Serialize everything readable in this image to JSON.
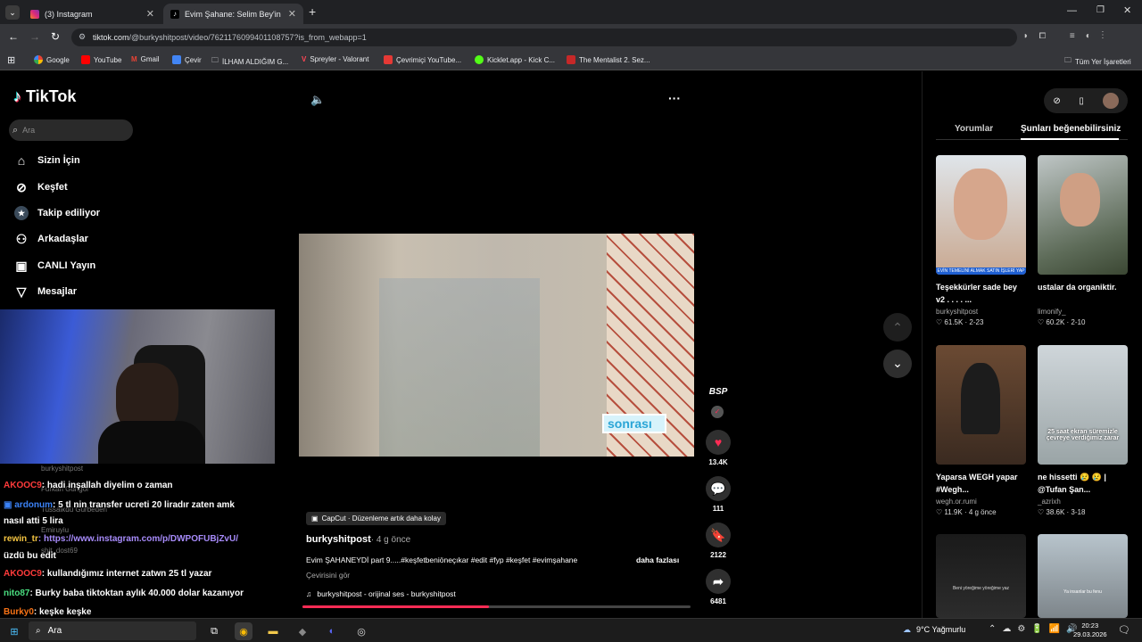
{
  "browser": {
    "tabs": [
      {
        "label": "(3) Instagram"
      },
      {
        "label": "Evim Şahane: Selim Bey'in Dönü"
      }
    ],
    "url_host": "tiktok.com",
    "url_path": "/@burkyshitpost/video/7621176099401108757?is_from_webapp=1",
    "bookmarks": [
      "Google",
      "YouTube",
      "Gmail",
      "Çevir",
      "İLHAM ALDIĞIM G...",
      "Spreyler - Valorant",
      "Çevrimiçi YouTube...",
      "Kicklet.app - Kick C...",
      "The Mentalist 2. Sez..."
    ],
    "bookmarks_right": "Tüm Yer İşaretleri"
  },
  "sidebar": {
    "logo": "TikTok",
    "search_placeholder": "Ara",
    "items": [
      {
        "label": "Sizin İçin",
        "icon": "home-icon"
      },
      {
        "label": "Keşfet",
        "icon": "compass-icon"
      },
      {
        "label": "Takip ediliyor",
        "icon": "following-icon"
      },
      {
        "label": "Arkadaşlar",
        "icon": "friends-icon"
      },
      {
        "label": "CANLI Yayın",
        "icon": "live-icon"
      },
      {
        "label": "Mesajlar",
        "icon": "messages-icon"
      }
    ]
  },
  "video": {
    "caption_overlay": "sonrası",
    "capcut": "CapCut · Düzenleme artık daha kolay",
    "author": "burkyshitpost",
    "age": "· 4 g önce",
    "description": "Evim ŞAHANEYDİ part 9.....#keşfetbeniöneçıkar #edit #fyp #keşfet #evimşahane",
    "more": "daha fazlası",
    "translate": "Çevirisini gör",
    "sound": "burkyshitpost - orijinal ses - burkyshitpost",
    "progress": 0.48,
    "avatar_label": "BSP"
  },
  "actions": {
    "likes": "13.4K",
    "comments": "111",
    "saves": "2122",
    "shares": "6481"
  },
  "rightpanel": {
    "tabs": [
      "Yorumlar",
      "Şunları beğenebilirsiniz"
    ],
    "cards": [
      {
        "title": "Teşekkürler sade bey v2 . . . . ...",
        "author": "burkyshitpost",
        "likes": "61.5K",
        "date": "2-23",
        "overlay": "EVİN TEMELİNİ ALMAK SATIN İŞLERİ YAP"
      },
      {
        "title": "ustalar da organiktir.",
        "author": "limonify_",
        "likes": "60.2K",
        "date": "2-10",
        "overlay": ""
      },
      {
        "title": "Yaparsa WEGH yapar #Wegh...",
        "author": "wegh.or.rumi",
        "likes": "11.9K",
        "date": "4 g önce",
        "overlay": ""
      },
      {
        "title": "ne hissetti 😢 😢 | @Tufan Şan...",
        "author": "_azrixh",
        "likes": "38.6K",
        "date": "3-18",
        "overlay": "25 saat ekran süremizle çevreye verdiğimiz zarar"
      },
      {
        "title": "",
        "author": "",
        "likes": "",
        "date": "",
        "overlay": "Beni yöreğime yöreğime yaz"
      },
      {
        "title": "",
        "author": "",
        "likes": "",
        "date": "",
        "overlay": "Ya insanlar bu fenu"
      }
    ]
  },
  "chat": [
    {
      "user": "AKOOC9",
      "text": ": hadi inşallah diyelim o zaman",
      "color": "#ff3b3b"
    },
    {
      "user": "ardonum",
      "text": ": 5 tl nin transfer ucreti 20 liradır zaten amk",
      "color": "#3b82f6"
    },
    {
      "user": "",
      "text": "nasıl atti 5 lira",
      "color": "#fff"
    },
    {
      "user": "rewin_tr",
      "text": ": https://www.instagram.com/p/DWPOFUBjZvU/",
      "color": "#f5c542"
    },
    {
      "user": "",
      "text": "üzdü bu edit",
      "color": "#fff"
    },
    {
      "user": "AKOOC9",
      "text": ": kullandığımız internet zatwn 25 tl yazar",
      "color": "#ff3b3b"
    },
    {
      "user": "nito87",
      "text": ": Burky baba tiktoktan aylık 40.000 dolar kazanıyor",
      "color": "#4ade80"
    },
    {
      "user": "Burky0",
      "text": ": keşke keşke",
      "color": "#f97316"
    }
  ],
  "faded_names": [
    "burkyshitpost",
    "Furkan Güngör",
    "Tussaikdü Gurbeden",
    "Emiruyiu",
    "shit_dost69"
  ],
  "taskbar": {
    "search": "Ara",
    "weather": "9°C  Yağmurlu",
    "time": "20:23",
    "date": "29.03.2026"
  }
}
